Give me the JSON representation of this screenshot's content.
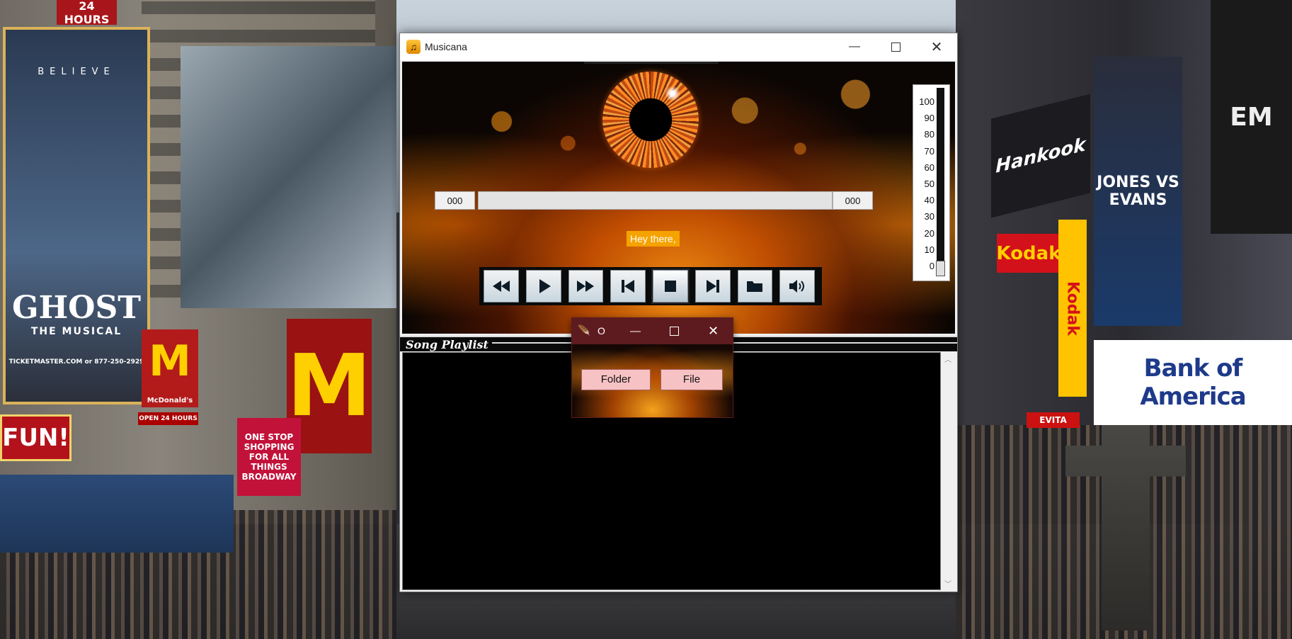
{
  "window": {
    "title": "Musicana",
    "controls": {
      "minimize_icon": "minimize-icon",
      "maximize_icon": "maximize-icon",
      "close_icon": "close-icon"
    }
  },
  "player": {
    "elapsed_time": "000",
    "total_time": "000",
    "lyric_text": "Hey there,",
    "progress": 0,
    "controls": [
      {
        "name": "rewind-button",
        "icon": "rewind-icon"
      },
      {
        "name": "play-button",
        "icon": "play-icon"
      },
      {
        "name": "fast-forward-button",
        "icon": "fast-forward-icon"
      },
      {
        "name": "previous-track-button",
        "icon": "skip-back-icon"
      },
      {
        "name": "stop-button",
        "icon": "stop-icon"
      },
      {
        "name": "next-track-button",
        "icon": "skip-forward-icon"
      },
      {
        "name": "open-folder-button",
        "icon": "folder-icon"
      },
      {
        "name": "volume-button",
        "icon": "speaker-icon"
      }
    ],
    "volume": {
      "scale": [
        "100",
        "90",
        "80",
        "70",
        "60",
        "50",
        "40",
        "30",
        "20",
        "10",
        "0"
      ],
      "level": 5
    }
  },
  "playlist": {
    "title": "Song Playlist",
    "items": []
  },
  "dialog": {
    "title": "O",
    "folder_label": "Folder",
    "file_label": "File"
  },
  "desktop": {
    "billboards": {
      "ghost_title": "GHOST",
      "ghost_subtitle": "THE MUSICAL",
      "ghost_tagline": "BELIEVE",
      "ghost_url": "TICKETMASTER.COM or 877-250-2929",
      "hankook": "Hankook",
      "kodak": "Kodak",
      "bank": "Bank of America",
      "fun": "FUN!",
      "mcdonalds": "McDonald's",
      "open_24": "OPEN 24 HOURS",
      "shopping": "ONE STOP SHOPPING FOR ALL THINGS BROADWAY",
      "ufc": "JONES VS EVANS",
      "evita": "EVITA",
      "hours": "24 HOURS"
    }
  }
}
